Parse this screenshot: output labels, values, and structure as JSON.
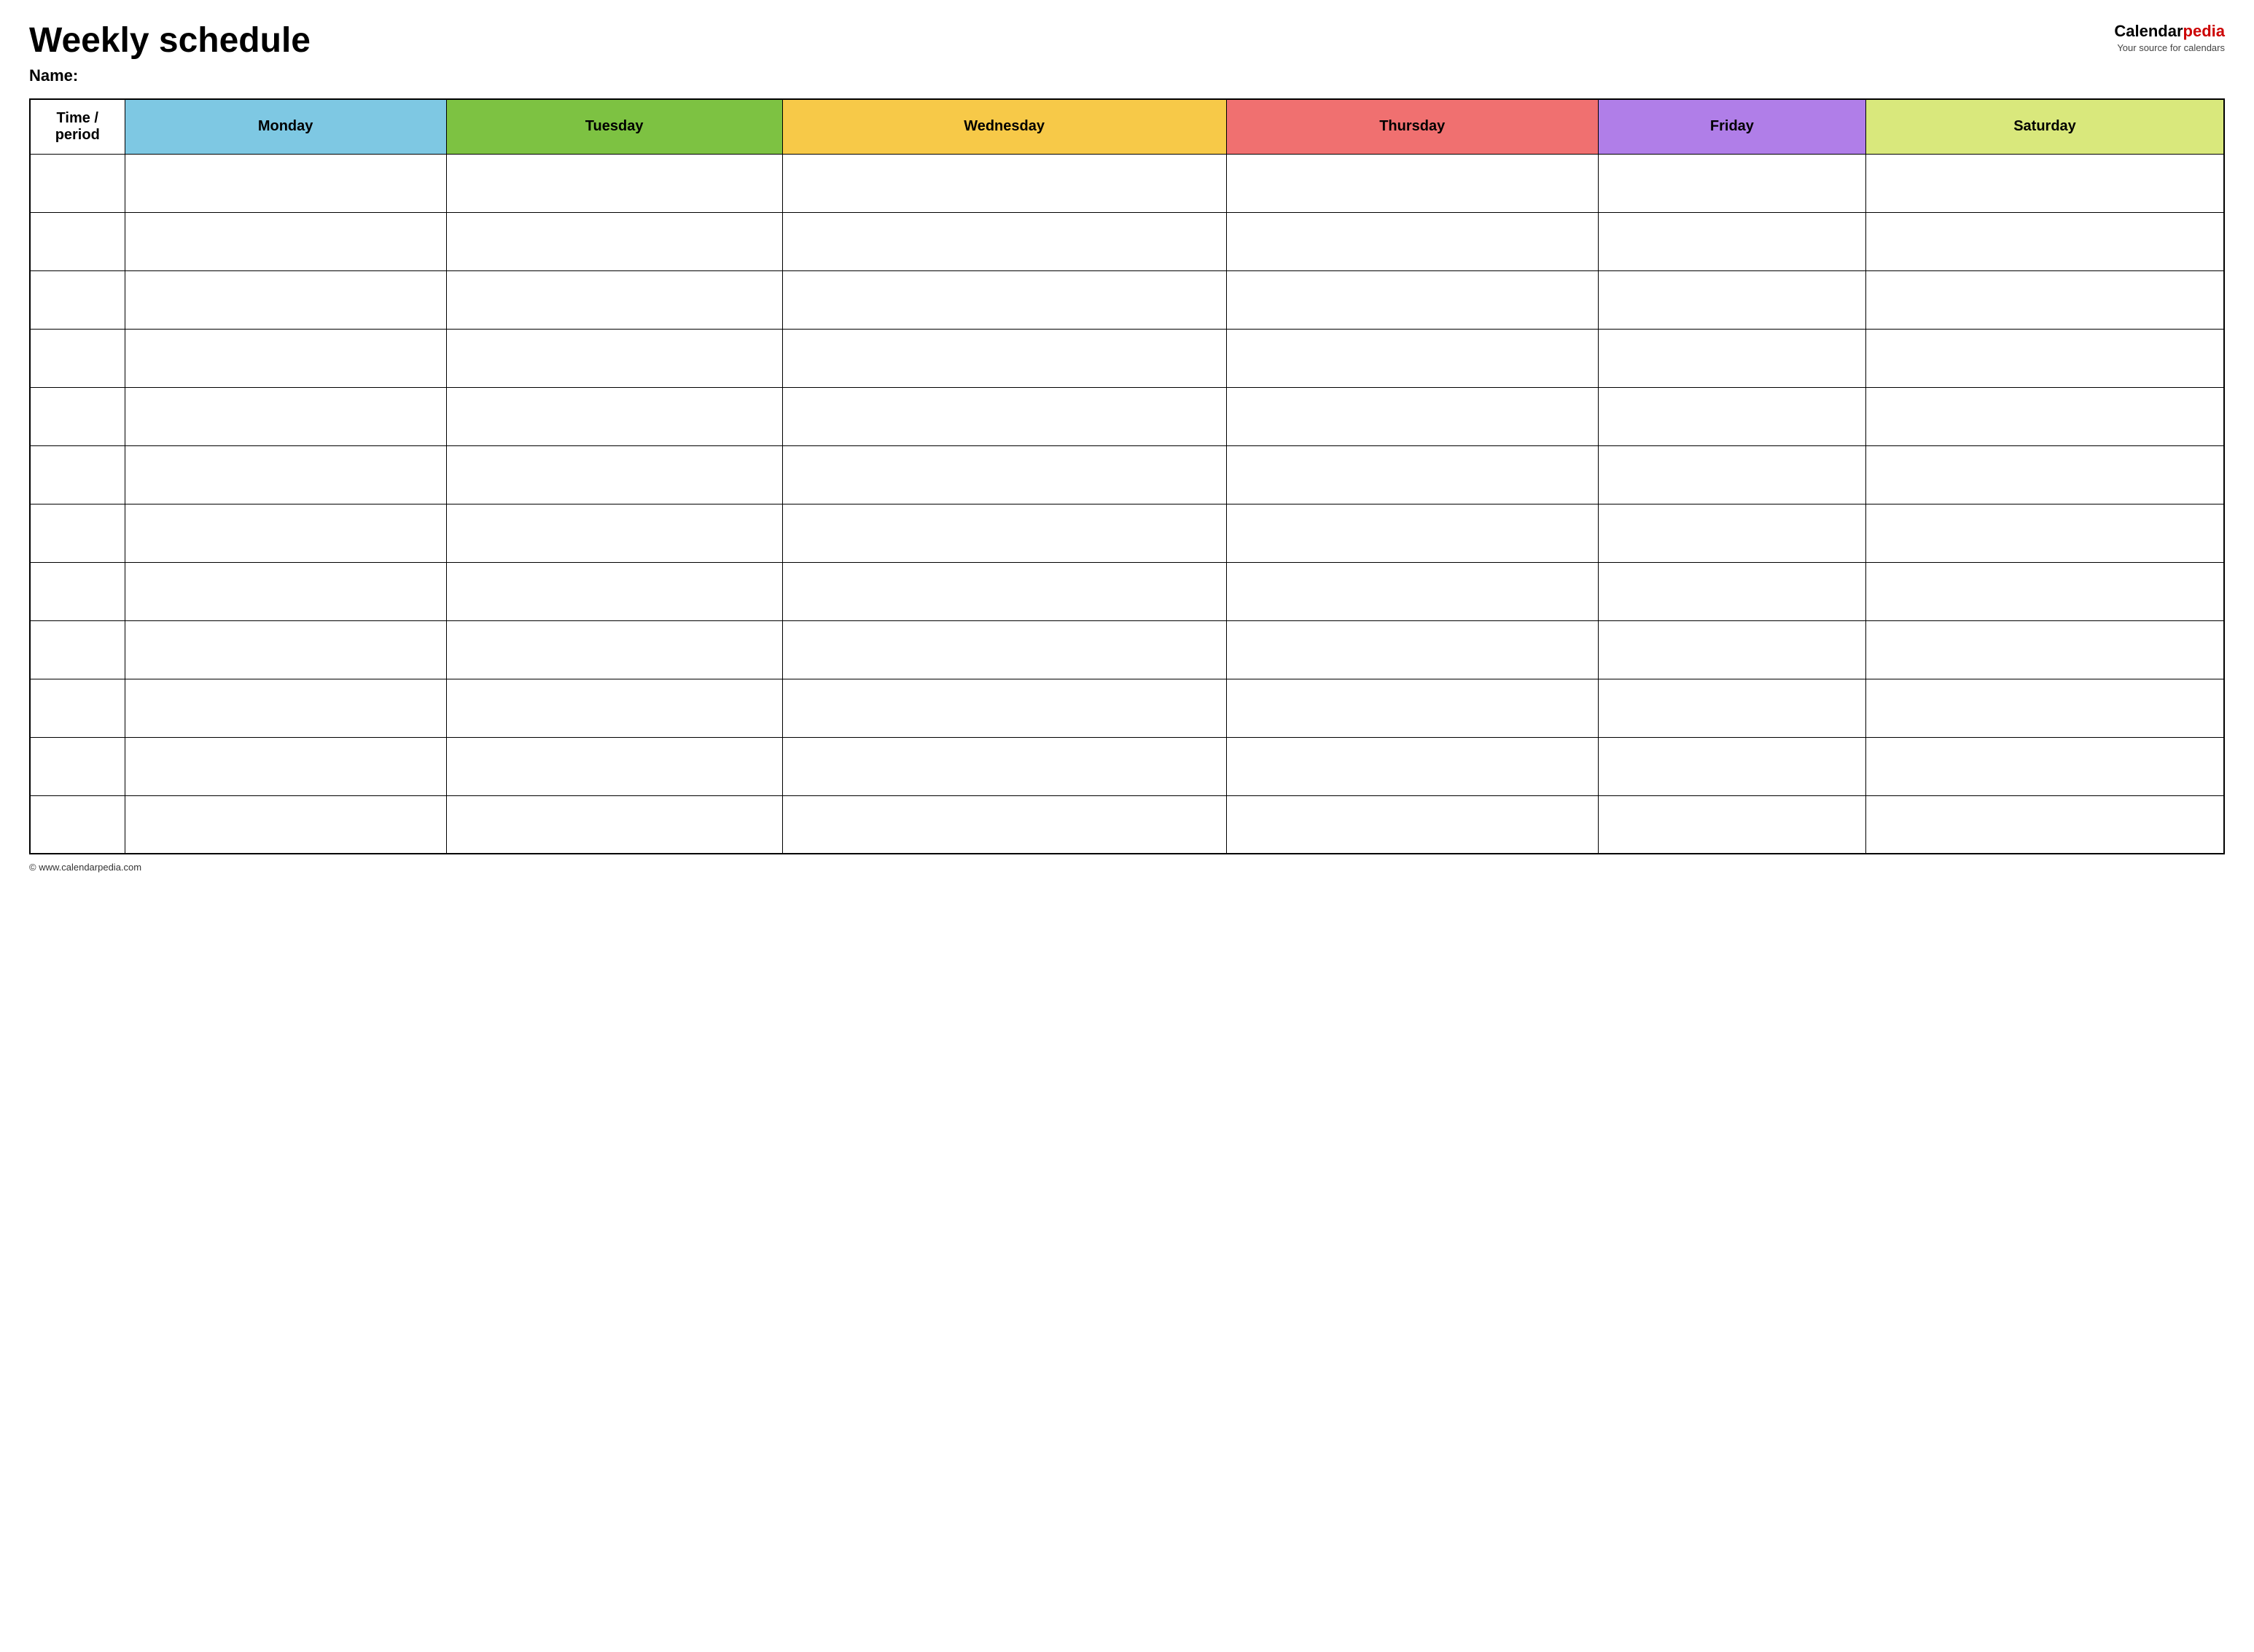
{
  "header": {
    "title": "Weekly schedule",
    "name_label": "Name:",
    "logo_calendar": "Calendar",
    "logo_pedia": "pedia",
    "logo_tagline": "Your source for calendars"
  },
  "table": {
    "columns": [
      {
        "id": "time",
        "label": "Time / period",
        "color_class": "th-time"
      },
      {
        "id": "monday",
        "label": "Monday",
        "color_class": "th-monday"
      },
      {
        "id": "tuesday",
        "label": "Tuesday",
        "color_class": "th-tuesday"
      },
      {
        "id": "wednesday",
        "label": "Wednesday",
        "color_class": "th-wednesday"
      },
      {
        "id": "thursday",
        "label": "Thursday",
        "color_class": "th-thursday"
      },
      {
        "id": "friday",
        "label": "Friday",
        "color_class": "th-friday"
      },
      {
        "id": "saturday",
        "label": "Saturday",
        "color_class": "th-saturday"
      }
    ],
    "row_count": 12
  },
  "footer": {
    "url": "© www.calendarpedia.com"
  }
}
